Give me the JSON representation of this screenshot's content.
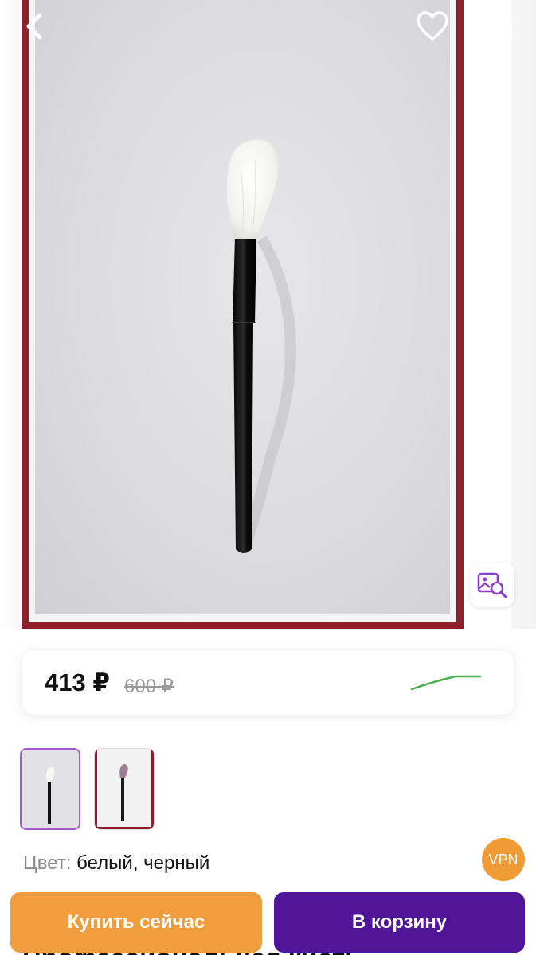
{
  "price": {
    "current": "413 ₽",
    "old": "600 ₽"
  },
  "color": {
    "label": "Цвет:",
    "value": "белый, черный"
  },
  "thumbnails": [
    {
      "name": "thumbnail-white-brush",
      "selected": true
    },
    {
      "name": "thumbnail-dark-brush",
      "selected": false
    }
  ],
  "vpn_badge": "VPN",
  "title_peek": "Профессиональная кисть",
  "actions": {
    "buy_now": "Купить сейчас",
    "add_to_cart": "В корзину"
  },
  "icons": {
    "back": "chevron-left-icon",
    "favorite": "heart-icon",
    "share": "share-icon",
    "image_search": "image-search-icon"
  },
  "colors": {
    "frame": "#8f1d2a",
    "buy_now": "#f29d3d",
    "cart": "#51159a",
    "accent": "#a05ac9",
    "trend": "#4caf50"
  }
}
